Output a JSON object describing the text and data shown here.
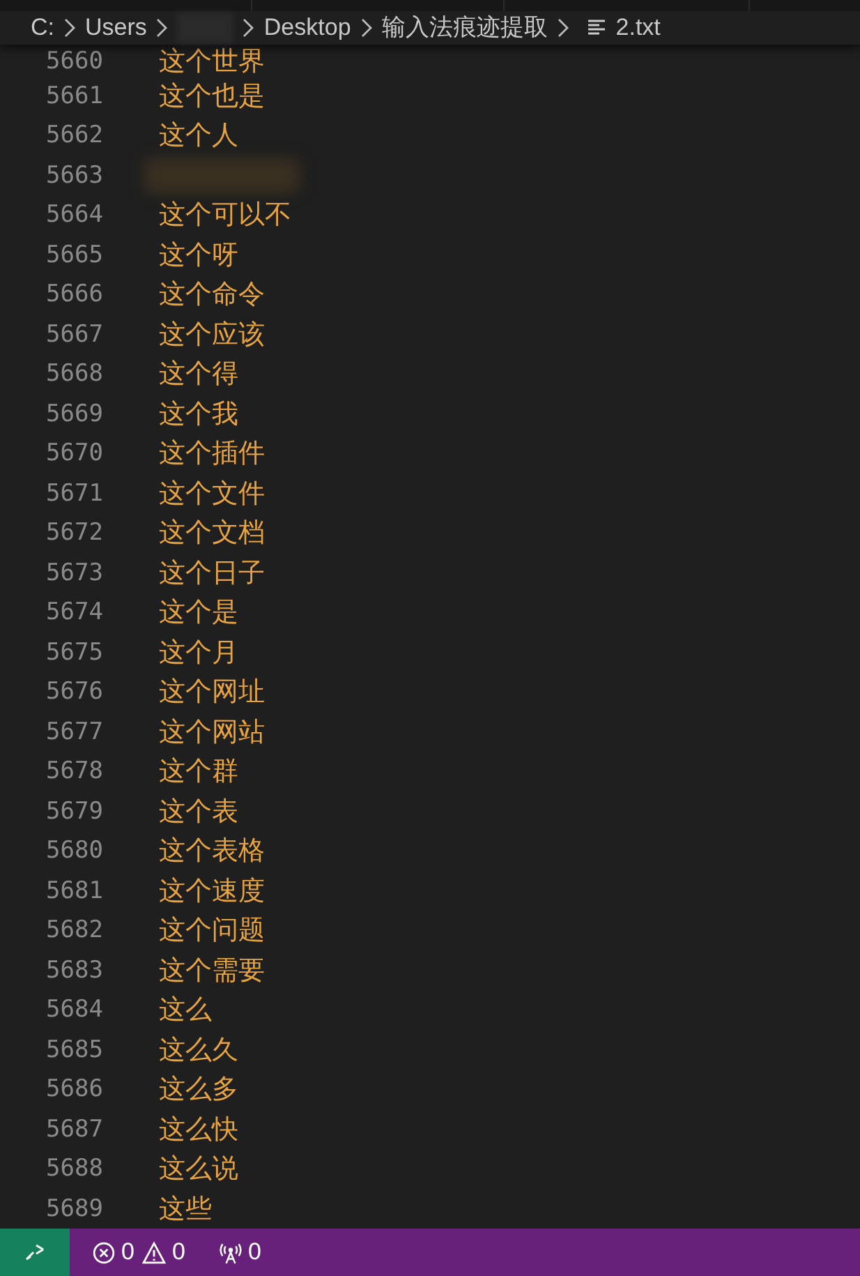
{
  "breadcrumb": [
    {
      "kind": "folder",
      "label": "C:"
    },
    {
      "kind": "folder",
      "label": "Users"
    },
    {
      "kind": "blurred"
    },
    {
      "kind": "folder",
      "label": "Desktop"
    },
    {
      "kind": "folder",
      "label": "输入法痕迹提取"
    },
    {
      "kind": "file",
      "label": "2.txt"
    }
  ],
  "lines": [
    {
      "number": "5660",
      "text": "这个世界"
    },
    {
      "number": "5661",
      "text": "这个也是"
    },
    {
      "number": "5662",
      "text": "这个人"
    },
    {
      "number": "5663",
      "blurred": true
    },
    {
      "number": "5664",
      "text": "这个可以不"
    },
    {
      "number": "5665",
      "text": "这个呀"
    },
    {
      "number": "5666",
      "text": "这个命令"
    },
    {
      "number": "5667",
      "text": "这个应该"
    },
    {
      "number": "5668",
      "text": "这个得"
    },
    {
      "number": "5669",
      "text": "这个我"
    },
    {
      "number": "5670",
      "text": "这个插件"
    },
    {
      "number": "5671",
      "text": "这个文件"
    },
    {
      "number": "5672",
      "text": "这个文档"
    },
    {
      "number": "5673",
      "text": "这个日子"
    },
    {
      "number": "5674",
      "text": "这个是"
    },
    {
      "number": "5675",
      "text": "这个月"
    },
    {
      "number": "5676",
      "text": "这个网址"
    },
    {
      "number": "5677",
      "text": "这个网站"
    },
    {
      "number": "5678",
      "text": "这个群"
    },
    {
      "number": "5679",
      "text": "这个表"
    },
    {
      "number": "5680",
      "text": "这个表格"
    },
    {
      "number": "5681",
      "text": "这个速度"
    },
    {
      "number": "5682",
      "text": "这个问题"
    },
    {
      "number": "5683",
      "text": "这个需要"
    },
    {
      "number": "5684",
      "text": "这么"
    },
    {
      "number": "5685",
      "text": "这么久"
    },
    {
      "number": "5686",
      "text": "这么多"
    },
    {
      "number": "5687",
      "text": "这么快"
    },
    {
      "number": "5688",
      "text": "这么说"
    },
    {
      "number": "5689",
      "text": "这些"
    }
  ],
  "status_bar": {
    "errors": "0",
    "warnings": "0",
    "ports": "0"
  }
}
